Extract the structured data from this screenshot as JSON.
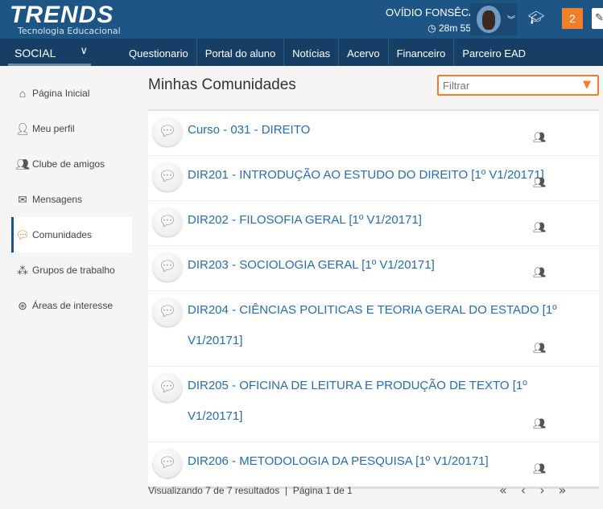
{
  "header": {
    "logo_main": "TRENDS",
    "logo_top": "tecno",
    "logo_sub": "Tecnologia Educacional",
    "user_name": "OVÍDIO FONSÊCA",
    "timer": "28m 55s",
    "notifications": "2"
  },
  "nav": {
    "section": "SOCIAL",
    "items": [
      "Questionario",
      "Portal do aluno",
      "Notícias",
      "Acervo",
      "Financeiro",
      "Parceiro EAD"
    ]
  },
  "sidebar": {
    "items": [
      {
        "label": "Página Inicial",
        "icon": "home-icon"
      },
      {
        "label": "Meu perfil",
        "icon": "user-icon"
      },
      {
        "label": "Clube de amigos",
        "icon": "users-icon"
      },
      {
        "label": "Mensagens",
        "icon": "envelope-icon"
      },
      {
        "label": "Comunidades",
        "icon": "comments-icon",
        "active": true
      },
      {
        "label": "Grupos de trabalho",
        "icon": "network-icon"
      },
      {
        "label": "Áreas de interesse",
        "icon": "circles-icon"
      }
    ]
  },
  "main": {
    "title": "Minhas Comunidades",
    "filter_placeholder": "Filtrar",
    "communities": [
      "Curso - 031 - DIREITO",
      "DIR201 - INTRODUÇÃO AO ESTUDO DO DIREITO [1º V1/20171]",
      "DIR202 - FILOSOFIA GERAL [1º V1/20171]",
      "DIR203 - SOCIOLOGIA GERAL [1º V1/20171]",
      "DIR204 - CIÊNCIAS POLITICAS E TEORIA GERAL DO ESTADO [1º V1/20171]",
      "DIR205 - OFICINA DE LEITURA E PRODUÇÃO DE TEXTO [1º V1/20171]",
      "DIR206 - METODOLOGIA DA PESQUISA [1º V1/20171]"
    ],
    "footer": {
      "results": "Visualizando 7 de 7 resultados",
      "separator": "|",
      "page": "Página 1 de 1"
    }
  },
  "colors": {
    "header": "#1d5585",
    "nav": "#173f66",
    "accent": "#f07f2c",
    "link": "#2a6ca8"
  }
}
